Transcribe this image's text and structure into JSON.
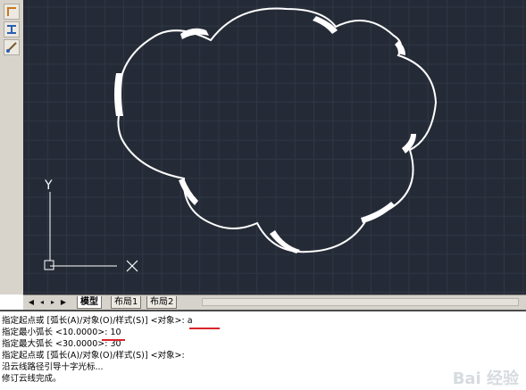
{
  "tabs": [
    {
      "label": "模型",
      "active": true
    },
    {
      "label": "布局1",
      "active": false
    },
    {
      "label": "布局2",
      "active": false
    }
  ],
  "ucs": {
    "y_label": "Y"
  },
  "command_lines": [
    {
      "prefix": "指定起点或 [弧长(A)/对象(O)/样式(S)] <对象>: ",
      "value": "a"
    },
    {
      "prefix": "指定最小弧长 <10.0000>: ",
      "value": "10"
    },
    {
      "prefix": "指定最大弧长 <30.0000>: ",
      "value": "30"
    },
    {
      "prefix": "指定起点或 [弧长(A)/对象(O)/样式(S)] <对象>:",
      "value": ""
    },
    {
      "prefix": "沿云线路径引导十字光标...",
      "value": ""
    },
    {
      "prefix": "修订云线完成。",
      "value": ""
    }
  ],
  "watermark": "Bai 经验",
  "colors": {
    "canvas": "#252b36",
    "grid": "#2f3746",
    "cloud": "#ffffff",
    "underline": "#d9242a"
  }
}
